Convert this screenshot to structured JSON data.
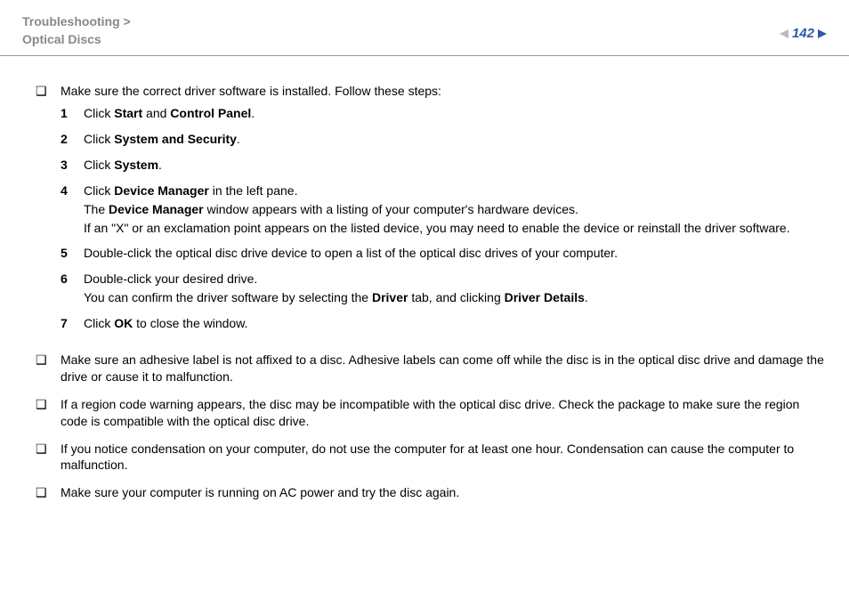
{
  "breadcrumb": {
    "line1": "Troubleshooting >",
    "line2": "Optical Discs"
  },
  "page": "142",
  "b0": {
    "intro": "Make sure the correct driver software is installed. Follow these steps:",
    "steps": {
      "s1": {
        "pre": "Click ",
        "b1": "Start",
        "mid": " and ",
        "b2": "Control Panel",
        "post": "."
      },
      "s2": {
        "pre": "Click ",
        "b1": "System and Security",
        "post": "."
      },
      "s3": {
        "pre": "Click ",
        "b1": "System",
        "post": "."
      },
      "s4": {
        "pre": "Click ",
        "b1": "Device Manager",
        "post": " in the left pane.",
        "l2a": "The ",
        "l2b": "Device Manager",
        "l2c": " window appears with a listing of your computer's hardware devices.",
        "l3": "If an \"X\" or an exclamation point appears on the listed device, you may need to enable the device or reinstall the driver software."
      },
      "s5": "Double-click the optical disc drive device to open a list of the optical disc drives of your computer.",
      "s6": {
        "l1": "Double-click your desired drive.",
        "l2a": "You can confirm the driver software by selecting the ",
        "l2b": "Driver",
        "l2c": " tab, and clicking ",
        "l2d": "Driver Details",
        "l2e": "."
      },
      "s7": {
        "pre": "Click ",
        "b1": "OK",
        "post": " to close the window."
      }
    }
  },
  "b1": "Make sure an adhesive label is not affixed to a disc. Adhesive labels can come off while the disc is in the optical disc drive and damage the drive or cause it to malfunction.",
  "b2": "If a region code warning appears, the disc may be incompatible with the optical disc drive. Check the package to make sure the region code is compatible with the optical disc drive.",
  "b3": "If you notice condensation on your computer, do not use the computer for at least one hour. Condensation can cause the computer to malfunction.",
  "b4": "Make sure your computer is running on AC power and try the disc again."
}
